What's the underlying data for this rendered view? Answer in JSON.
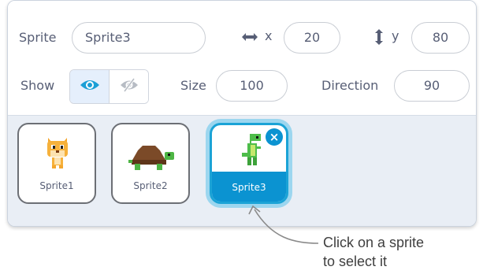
{
  "sprite_info": {
    "sprite_label": "Sprite",
    "sprite_name": "Sprite3",
    "x_label": "x",
    "x_value": "20",
    "y_label": "y",
    "y_value": "80",
    "show_label": "Show",
    "show_visible": true,
    "size_label": "Size",
    "size_value": "100",
    "direction_label": "Direction",
    "direction_value": "90"
  },
  "sprites": [
    {
      "name": "Sprite1",
      "costume": "cat-sprite-icon",
      "selected": false
    },
    {
      "name": "Sprite2",
      "costume": "tortoise-sprite-icon",
      "selected": false
    },
    {
      "name": "Sprite3",
      "costume": "dinosaur-sprite-icon",
      "selected": true
    }
  ],
  "callout": {
    "line1": "Click on a sprite",
    "line2": "to select it"
  },
  "colors": {
    "accent": "#0b93d1",
    "accent_glow": "#9cd6ef",
    "text": "#575e75",
    "sprite_pane_bg": "#e9eef5"
  }
}
